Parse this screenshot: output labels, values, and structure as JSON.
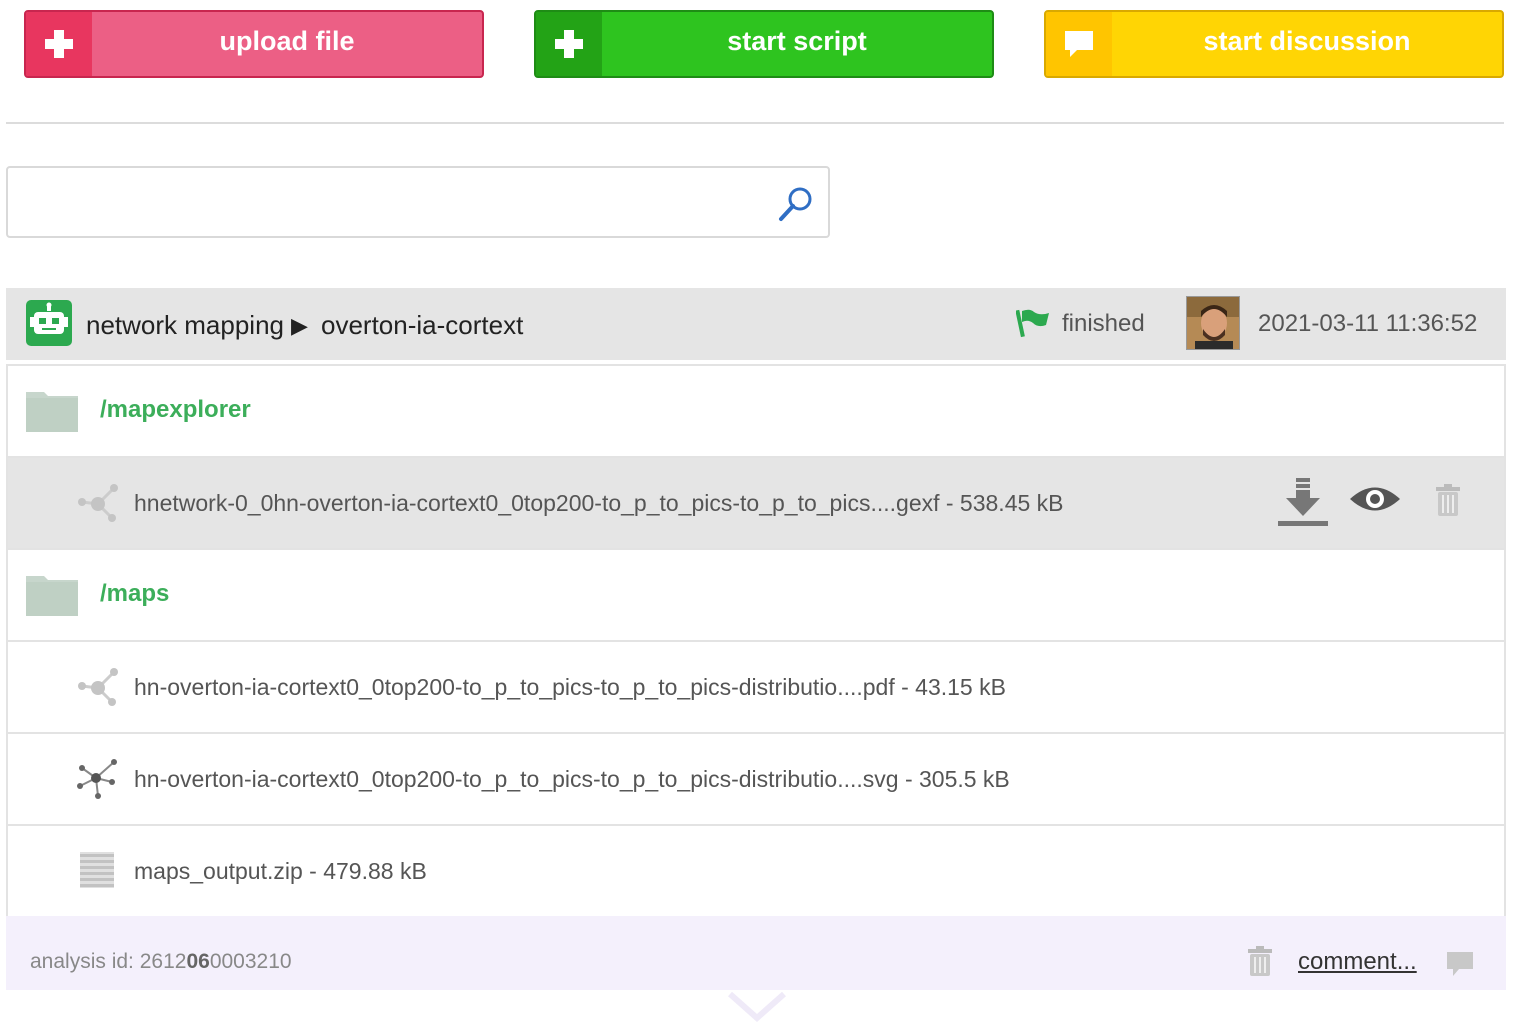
{
  "toolbar": {
    "upload_label": "upload file",
    "script_label": "start script",
    "discussion_label": "start discussion",
    "upload_icon": "plus-icon",
    "script_icon": "plus-icon",
    "discussion_icon": "speech-bubble-icon",
    "colors": {
      "upload": "#ec5f85",
      "script": "#2ec41f",
      "discussion": "#ffd504"
    }
  },
  "search": {
    "value": "",
    "placeholder": ""
  },
  "analysis": {
    "tool": "network mapping",
    "separator": "▶",
    "name": "overton-ia-cortext",
    "status": "finished",
    "timestamp": "2021-03-11 11:36:52",
    "accent_color": "#3cae5a"
  },
  "folders": [
    {
      "name": "/mapexplorer",
      "files": [
        {
          "name": "hnetwork-0_0hn-overton-ia-cortext0_0top200-to_p_to_pics-to_p_to_pics....gexf - 538.45 kB",
          "icon": "network-graph-icon"
        }
      ]
    },
    {
      "name": "/maps",
      "files": [
        {
          "name": "hn-overton-ia-cortext0_0top200-to_p_to_pics-to_p_to_pics-distributio....pdf - 43.15 kB",
          "icon": "network-graph-icon"
        },
        {
          "name": "hn-overton-ia-cortext0_0top200-to_p_to_pics-to_p_to_pics-distributio....svg - 305.5 kB",
          "icon": "network-cluster-icon"
        },
        {
          "name": "maps_output.zip - 479.88 kB",
          "icon": "archive-icon"
        }
      ]
    }
  ],
  "footer": {
    "analysis_id_label": "analysis id:",
    "analysis_id_prefix": "2612",
    "analysis_id_bold": "06",
    "analysis_id_suffix": "0003210",
    "comment_label": "comment..."
  }
}
